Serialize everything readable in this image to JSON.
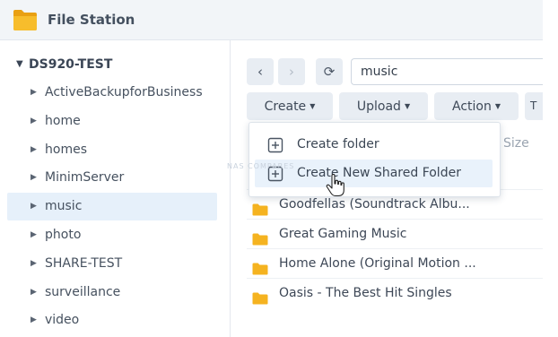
{
  "app": {
    "title": "File Station",
    "icon": "folder-icon"
  },
  "tree": {
    "root_label": "DS920-TEST",
    "items": [
      {
        "label": "ActiveBackupforBusiness"
      },
      {
        "label": "home"
      },
      {
        "label": "homes"
      },
      {
        "label": "MinimServer"
      },
      {
        "label": "music"
      },
      {
        "label": "photo"
      },
      {
        "label": "SHARE-TEST"
      },
      {
        "label": "surveillance"
      },
      {
        "label": "video"
      }
    ],
    "selected_index": 4
  },
  "nav": {
    "back": "‹",
    "forward": "›",
    "refresh": "⟳",
    "path": "music"
  },
  "toolbar": {
    "create_label": "Create",
    "upload_label": "Upload",
    "action_label": "Action",
    "extra_label": "T"
  },
  "list": {
    "size_header": "Size",
    "files": [
      {
        "name": "Goodfellas (Soundtrack Albu..."
      },
      {
        "name": "Great Gaming Music"
      },
      {
        "name": "Home Alone (Original Motion ..."
      },
      {
        "name": "Oasis - The Best Hit Singles"
      }
    ]
  },
  "create_menu": {
    "items": [
      {
        "label": "Create folder",
        "icon": "add-folder-icon"
      },
      {
        "label": "Create New Shared Folder",
        "icon": "add-shared-folder-icon"
      }
    ],
    "hovered_index": 1
  },
  "watermark": "NAS COMPARES",
  "colors": {
    "folder": "#f5b320",
    "selection": "#e6f0fa",
    "button_bg": "#e8edf3"
  }
}
